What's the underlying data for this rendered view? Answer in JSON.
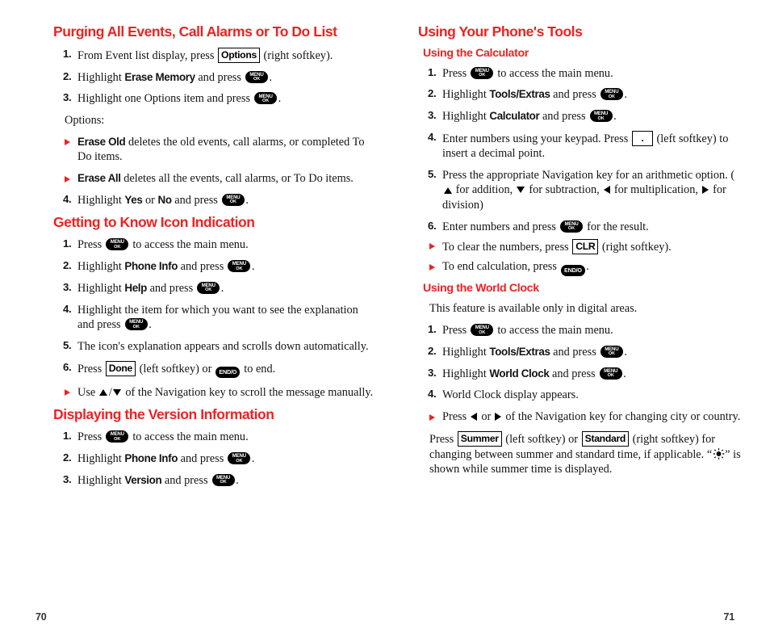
{
  "document": {
    "page_left": "70",
    "page_right": "71",
    "heading_color": "#EE2222",
    "bullet_color": "#EE2222"
  },
  "left_column": {
    "section1": {
      "heading": "Purging All Events, Call Alarms or To Do List",
      "steps": [
        {
          "num": "1.",
          "pre": "From Event list display, press ",
          "key": "Options",
          "post": " (right softkey)."
        },
        {
          "num": "2.",
          "pre": "Highlight ",
          "term": "Erase Memory",
          "mid": " and press ",
          "post": "."
        },
        {
          "num": "3.",
          "pre": "Highlight one Options item and press ",
          "post": "."
        }
      ],
      "options_label": "Options:",
      "bullets": [
        {
          "term": "Erase Old",
          "text": " deletes the old events, call alarms, or completed To Do items."
        },
        {
          "term": "Erase All",
          "text": " deletes all the events, call alarms, or To Do items."
        }
      ],
      "step4": {
        "num": "4.",
        "pre": "Highlight ",
        "term1": "Yes",
        "mid": " or ",
        "term2": "No",
        "post": " and press ",
        "end": "."
      }
    },
    "section2": {
      "heading": "Getting to Know Icon Indication",
      "steps": [
        {
          "num": "1.",
          "pre": "Press ",
          "post": " to access the main menu."
        },
        {
          "num": "2.",
          "pre": "Highlight ",
          "term": "Phone Info",
          "mid": " and press ",
          "post": "."
        },
        {
          "num": "3.",
          "pre": "Highlight ",
          "term": "Help",
          "mid": " and press ",
          "post": "."
        },
        {
          "num": "4.",
          "pre": "Highlight the item for which you want to see the explanation and press ",
          "post": "."
        },
        {
          "num": "5.",
          "pre": "The icon's explanation appears and scrolls down automatically."
        },
        {
          "num": "6.",
          "pre": "Press ",
          "key": "Done",
          "mid": " (left softkey) or ",
          "post": " to end."
        }
      ],
      "bullet_use": {
        "pre": "Use ",
        "mid": "/",
        "post": " of the Navigation key to scroll the message manually."
      }
    },
    "section3": {
      "heading": "Displaying the Version Information",
      "steps": [
        {
          "num": "1.",
          "pre": "Press ",
          "post": " to access the main menu."
        },
        {
          "num": "2.",
          "pre": "Highlight ",
          "term": "Phone Info",
          "mid": " and press ",
          "post": "."
        },
        {
          "num": "3.",
          "pre": "Highlight ",
          "term": "Version",
          "mid": " and press ",
          "post": "."
        }
      ]
    }
  },
  "right_column": {
    "heading": "Using Your Phone's Tools",
    "calculator": {
      "subheading": "Using the Calculator",
      "steps": [
        {
          "num": "1.",
          "pre": "Press ",
          "post": " to access the main menu."
        },
        {
          "num": "2.",
          "pre": "Highlight ",
          "term": "Tools/Extras",
          "mid": " and press ",
          "post": "."
        },
        {
          "num": "3.",
          "pre": "Highlight ",
          "term": "Calculator",
          "mid": " and press ",
          "post": "."
        },
        {
          "num": "4.",
          "pre": "Enter numbers using your keypad. Press ",
          "key": ".",
          "post": " (left softkey) to insert a decimal point."
        },
        {
          "num": "5.",
          "pre": "Press the appropriate Navigation key for an arithmetic option. (",
          "a1": " for addition, ",
          "a2": " for subtraction, ",
          "a3": " for multiplication, ",
          "a4": " for division)"
        },
        {
          "num": "6.",
          "pre": "Enter numbers and press ",
          "post": " for the result."
        }
      ],
      "bullets": [
        {
          "pre": "To clear the numbers, press ",
          "key": "CLR",
          "post": " (right softkey)."
        },
        {
          "pre": "To end calculation, press ",
          "post": "."
        }
      ]
    },
    "world_clock": {
      "subheading": "Using the World Clock",
      "intro": "This feature is available only in digital areas.",
      "steps": [
        {
          "num": "1.",
          "pre": "Press ",
          "post": " to access the main menu."
        },
        {
          "num": "2.",
          "pre": "Highlight ",
          "term": "Tools/Extras",
          "mid": " and press ",
          "post": "."
        },
        {
          "num": "3.",
          "pre": "Highlight ",
          "term": "World Clock",
          "mid": " and press ",
          "post": "."
        },
        {
          "num": "4.",
          "pre": "World Clock display appears."
        }
      ],
      "bullet_nav": {
        "pre": "Press ",
        "mid": " or ",
        "post": " of the Navigation key for changing city or country."
      },
      "closing": {
        "p1_pre": "Press ",
        "key1": "Summer",
        "p1_mid": " (left softkey) or ",
        "key2": "Standard",
        "p1_post": " (right softkey) for changing between summer and standard time, if applicable.",
        "p2_pre": "“",
        "p2_post": "” is shown while summer time is displayed."
      }
    }
  },
  "keys": {
    "menu_line1": "MENU",
    "menu_line2": "OK",
    "end_label": "END/O"
  }
}
